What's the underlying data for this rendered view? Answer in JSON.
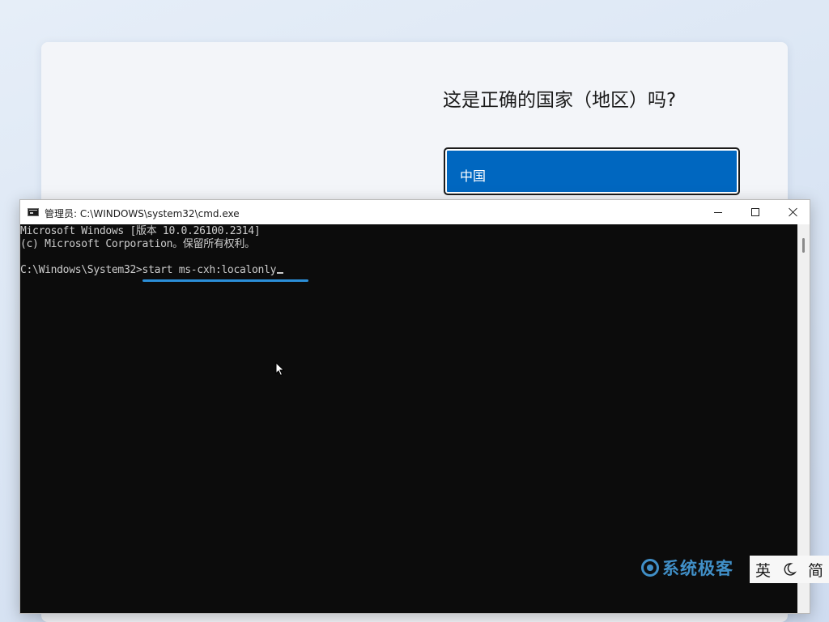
{
  "oobe": {
    "question": "这是正确的国家（地区）吗?",
    "selected_country": "中国"
  },
  "cmd_window": {
    "title": "管理员: C:\\WINDOWS\\system32\\cmd.exe",
    "lines": [
      "Microsoft Windows [版本 10.0.26100.2314]",
      "(c) Microsoft Corporation。保留所有权利。"
    ],
    "prompt": "C:\\Windows\\System32>",
    "command": "start ms-cxh:localonly"
  },
  "watermark": {
    "text": "系统极客"
  },
  "ime": {
    "language": "英",
    "mode": "简"
  },
  "colors": {
    "accent": "#0067c0",
    "console_bg": "#0c0c0c",
    "console_fg": "#cccccc",
    "highlight_underline": "#2b8fd8"
  },
  "icons": {
    "cmd": "command-prompt-icon",
    "minimize": "minimize-icon",
    "maximize": "maximize-icon",
    "close": "close-icon",
    "pointer": "mouse-pointer-icon",
    "moon": "half-width-moon-icon"
  }
}
